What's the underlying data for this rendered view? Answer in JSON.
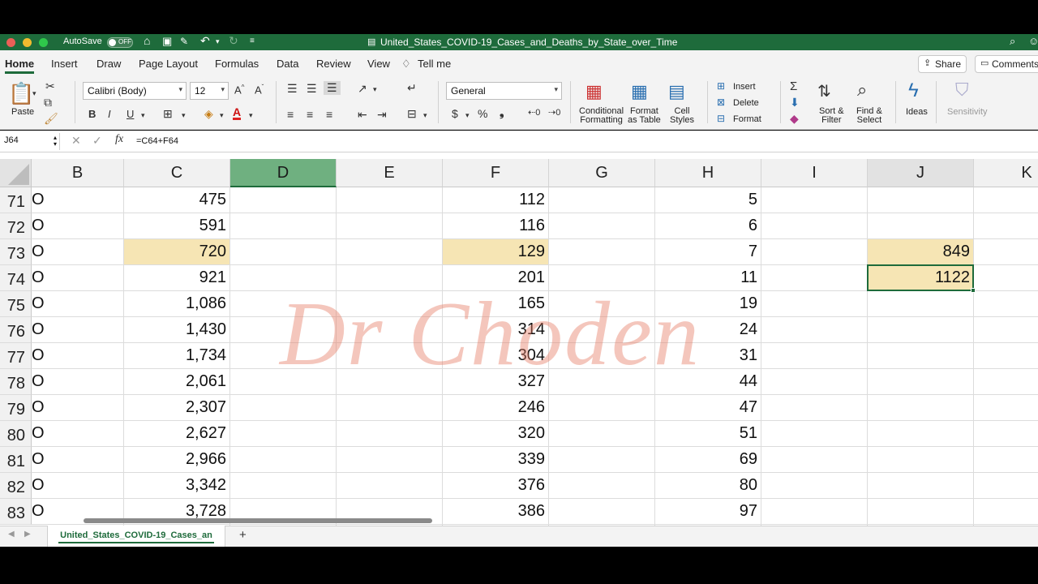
{
  "window": {
    "autosave_label": "AutoSave",
    "autosave_state": "OFF",
    "title": "United_States_COVID-19_Cases_and_Deaths_by_State_over_Time",
    "colors": {
      "excel_green": "#1e6b3b",
      "highlight": "#f6e5b4",
      "selected_col": "#6fb080"
    }
  },
  "ribbon_tabs": [
    "Home",
    "Insert",
    "Draw",
    "Page Layout",
    "Formulas",
    "Data",
    "Review",
    "View"
  ],
  "tell_me": "Tell me",
  "share_label": "Share",
  "comments_label": "Comments",
  "ribbon": {
    "paste_label": "Paste",
    "font_name": "Calibri (Body)",
    "font_size": "12",
    "number_format": "General",
    "conditional_formatting": [
      "Conditional",
      "Formatting"
    ],
    "format_as_table": [
      "Format",
      "as Table"
    ],
    "cell_styles": [
      "Cell",
      "Styles"
    ],
    "insert_label": "Insert",
    "delete_label": "Delete",
    "format_label": "Format",
    "sort_filter": [
      "Sort &",
      "Filter"
    ],
    "find_select": [
      "Find &",
      "Select"
    ],
    "ideas_label": "Ideas",
    "sensitivity_label": "Sensitivity"
  },
  "formula_bar": {
    "name_box": "J64",
    "formula": "=C64+F64"
  },
  "grid": {
    "columns": [
      "B",
      "C",
      "D",
      "E",
      "F",
      "G",
      "H",
      "I",
      "J",
      "K"
    ],
    "rows": [
      {
        "n": "71",
        "B": "O",
        "C": "475",
        "F": "112",
        "H": "5",
        "J": ""
      },
      {
        "n": "72",
        "B": "O",
        "C": "591",
        "F": "116",
        "H": "6",
        "J": ""
      },
      {
        "n": "73",
        "B": "O",
        "C": "720",
        "F": "129",
        "H": "7",
        "J": "849"
      },
      {
        "n": "74",
        "B": "O",
        "C": "921",
        "F": "201",
        "H": "11",
        "J": "1122"
      },
      {
        "n": "75",
        "B": "O",
        "C": "1,086",
        "F": "165",
        "H": "19",
        "J": ""
      },
      {
        "n": "76",
        "B": "O",
        "C": "1,430",
        "F": "314",
        "H": "24",
        "J": ""
      },
      {
        "n": "77",
        "B": "O",
        "C": "1,734",
        "F": "304",
        "H": "31",
        "J": ""
      },
      {
        "n": "78",
        "B": "O",
        "C": "2,061",
        "F": "327",
        "H": "44",
        "J": ""
      },
      {
        "n": "79",
        "B": "O",
        "C": "2,307",
        "F": "246",
        "H": "47",
        "J": ""
      },
      {
        "n": "80",
        "B": "O",
        "C": "2,627",
        "F": "320",
        "H": "51",
        "J": ""
      },
      {
        "n": "81",
        "B": "O",
        "C": "2,966",
        "F": "339",
        "H": "69",
        "J": ""
      },
      {
        "n": "82",
        "B": "O",
        "C": "3,342",
        "F": "376",
        "H": "80",
        "J": ""
      },
      {
        "n": "83",
        "B": "O",
        "C": "3,728",
        "F": "386",
        "H": "97",
        "J": ""
      }
    ]
  },
  "watermark": "Dr Choden",
  "sheet_tab": "United_States_COVID-19_Cases_an"
}
